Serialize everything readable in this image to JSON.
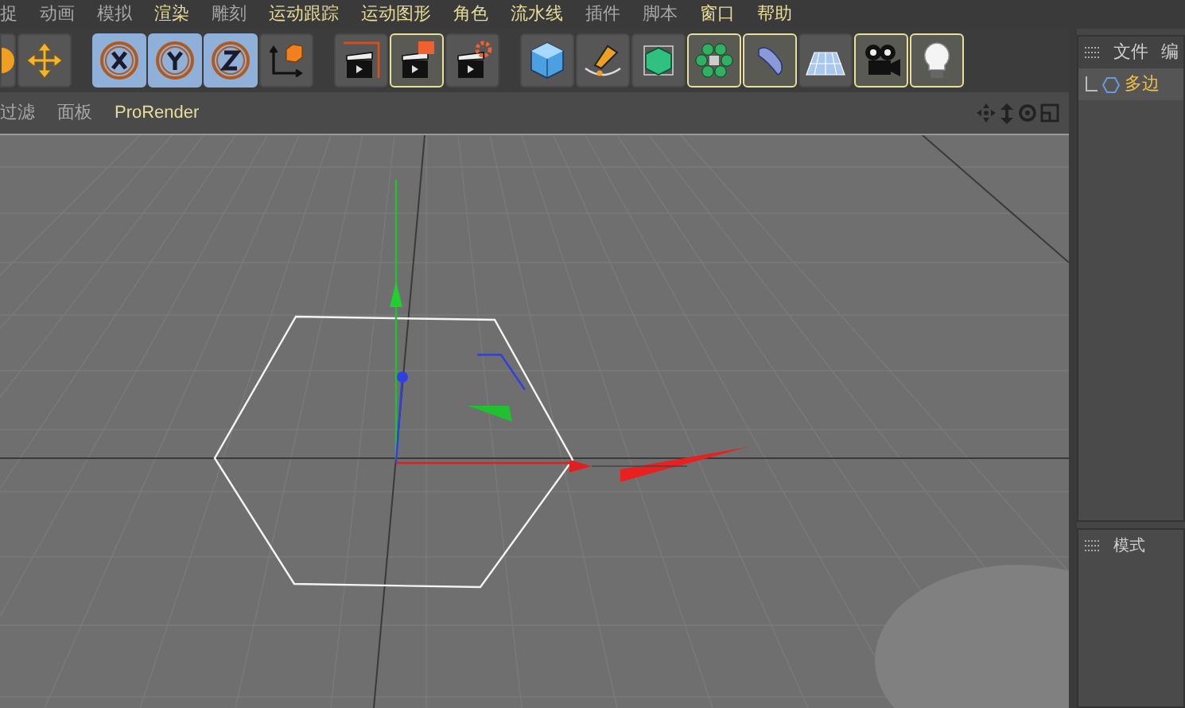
{
  "menu": [
    {
      "label": "捉",
      "highlighted": false
    },
    {
      "label": "动画",
      "highlighted": false
    },
    {
      "label": "模拟",
      "highlighted": false
    },
    {
      "label": "渲染",
      "highlighted": true
    },
    {
      "label": "雕刻",
      "highlighted": false
    },
    {
      "label": "运动跟踪",
      "highlighted": true
    },
    {
      "label": "运动图形",
      "highlighted": true
    },
    {
      "label": "角色",
      "highlighted": true
    },
    {
      "label": "流水线",
      "highlighted": true
    },
    {
      "label": "插件",
      "highlighted": false
    },
    {
      "label": "脚本",
      "highlighted": false
    },
    {
      "label": "窗口",
      "highlighted": true
    },
    {
      "label": "帮助",
      "highlighted": true
    }
  ],
  "toolbar": [
    [
      {
        "kind": "partial",
        "selected": false
      },
      {
        "kind": "move",
        "selected": false
      }
    ],
    [
      {
        "kind": "x",
        "selected": true
      },
      {
        "kind": "y",
        "selected": true
      },
      {
        "kind": "z",
        "selected": true
      },
      {
        "kind": "coords",
        "selected": false
      }
    ],
    [
      {
        "kind": "render-region",
        "selected": false
      },
      {
        "kind": "render-view",
        "selected": true
      },
      {
        "kind": "render-settings",
        "selected": false
      }
    ],
    [
      {
        "kind": "cube",
        "selected": false
      },
      {
        "kind": "pen",
        "selected": false
      },
      {
        "kind": "subdiv",
        "selected": false
      },
      {
        "kind": "cloner",
        "selected": true
      },
      {
        "kind": "deformer",
        "selected": true
      },
      {
        "kind": "floor",
        "selected": false
      },
      {
        "kind": "camera",
        "selected": true
      },
      {
        "kind": "light",
        "selected": true
      }
    ]
  ],
  "viewport": {
    "menu": [
      {
        "label": "过滤",
        "highlighted": false
      },
      {
        "label": "面板",
        "highlighted": false
      },
      {
        "label": "ProRender",
        "highlighted": true
      }
    ]
  },
  "objects_panel": {
    "tabs": [
      "文件",
      "编"
    ],
    "items": [
      {
        "label": "多边",
        "selected": true
      }
    ]
  },
  "attributes_panel": {
    "tabs": [
      "模式"
    ]
  }
}
